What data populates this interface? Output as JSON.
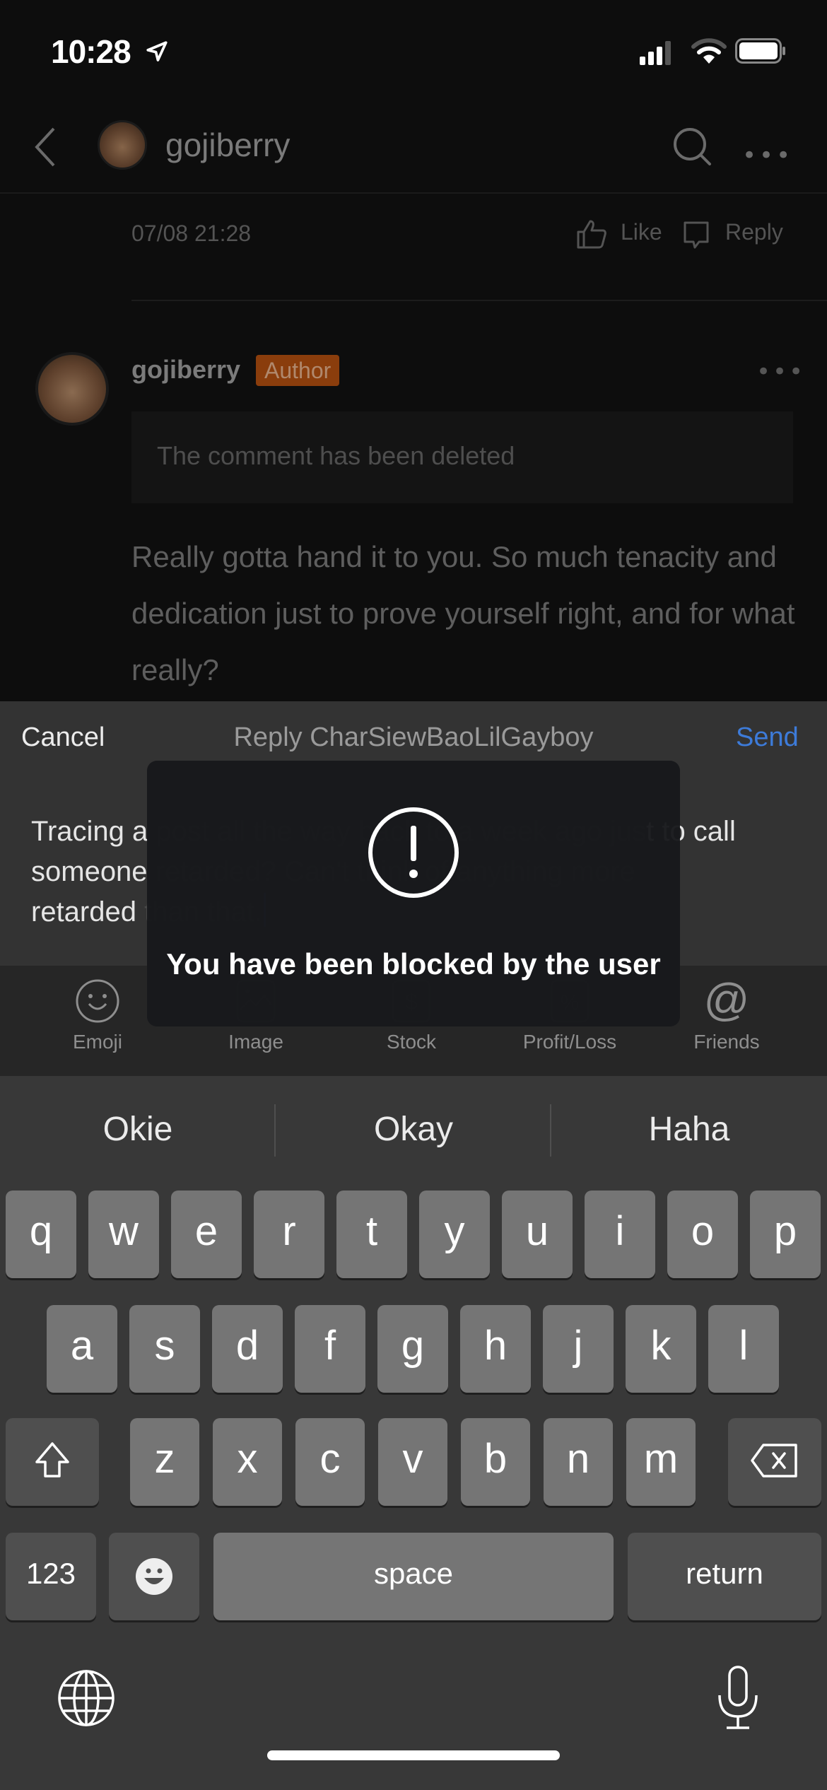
{
  "status_bar": {
    "time": "10:28",
    "icons": [
      "location-arrow-icon",
      "cellular-signal-icon",
      "wifi-icon",
      "battery-icon"
    ]
  },
  "nav": {
    "title": "gojiberry",
    "icons": [
      "back-chevron-icon",
      "search-icon",
      "more-icon"
    ]
  },
  "comment_1": {
    "timestamp": "07/08 21:28",
    "like_label": "Like",
    "reply_label": "Reply"
  },
  "comment_2": {
    "author": "gojiberry",
    "badge": "Author",
    "deleted_notice": "The comment has been deleted",
    "body": "Really gotta hand it to you. So much tenacity and dedication just to prove yourself right, and for what really?"
  },
  "composer": {
    "cancel_label": "Cancel",
    "title": "Reply CharSiewBaoLilGayboy",
    "send_label": "Send",
    "input_value_part1": "Tracing a",
    "input_value_part2": " post all the way back to a week ago jus",
    "input_value_part3": "t to call",
    "input_value_part4": "someone",
    "input_value_part5": " retarded? Can't think of anything more",
    "input_value_part6": "retarded",
    "input_value_part7": " than that.",
    "accent_color": "#3d7bd9"
  },
  "toolbar": {
    "items": [
      {
        "label": "Emoji",
        "icon": "emoji-icon"
      },
      {
        "label": "Image",
        "icon": "image-icon"
      },
      {
        "label": "Stock",
        "icon": "stock-icon"
      },
      {
        "label": "Profit/Loss",
        "icon": "profit-loss-icon"
      },
      {
        "label": "Friends",
        "icon": "at-icon"
      }
    ]
  },
  "toast": {
    "message": "You have been blocked by the user",
    "icon": "alert-icon"
  },
  "keyboard": {
    "suggestions": [
      "Okie",
      "Okay",
      "Haha"
    ],
    "row1": [
      "q",
      "w",
      "e",
      "r",
      "t",
      "y",
      "u",
      "i",
      "o",
      "p"
    ],
    "row2": [
      "a",
      "s",
      "d",
      "f",
      "g",
      "h",
      "j",
      "k",
      "l"
    ],
    "row3": [
      "z",
      "x",
      "c",
      "v",
      "b",
      "n",
      "m"
    ],
    "numbers_label": "123",
    "space_label": "space",
    "return_label": "return"
  }
}
